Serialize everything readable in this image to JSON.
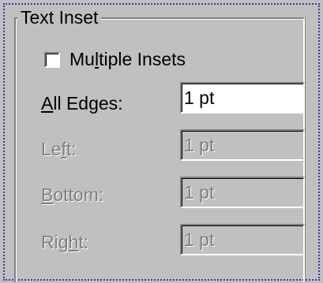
{
  "group": {
    "title": "Text Inset"
  },
  "multiple_insets": {
    "label_pre": "Mu",
    "label_accel": "l",
    "label_post": "tiple Insets",
    "checked": false
  },
  "fields": [
    {
      "label_pre": "",
      "label_accel": "A",
      "label_post": "ll Edges:",
      "value": "1 pt",
      "enabled": true
    },
    {
      "label_pre": "Le",
      "label_accel": "f",
      "label_post": "t:",
      "value": "1 pt",
      "enabled": false
    },
    {
      "label_pre": "",
      "label_accel": "B",
      "label_post": "ottom:",
      "value": "1 pt",
      "enabled": false
    },
    {
      "label_pre": "Rig",
      "label_accel": "h",
      "label_post": "t:",
      "value": "1 pt",
      "enabled": false
    }
  ]
}
